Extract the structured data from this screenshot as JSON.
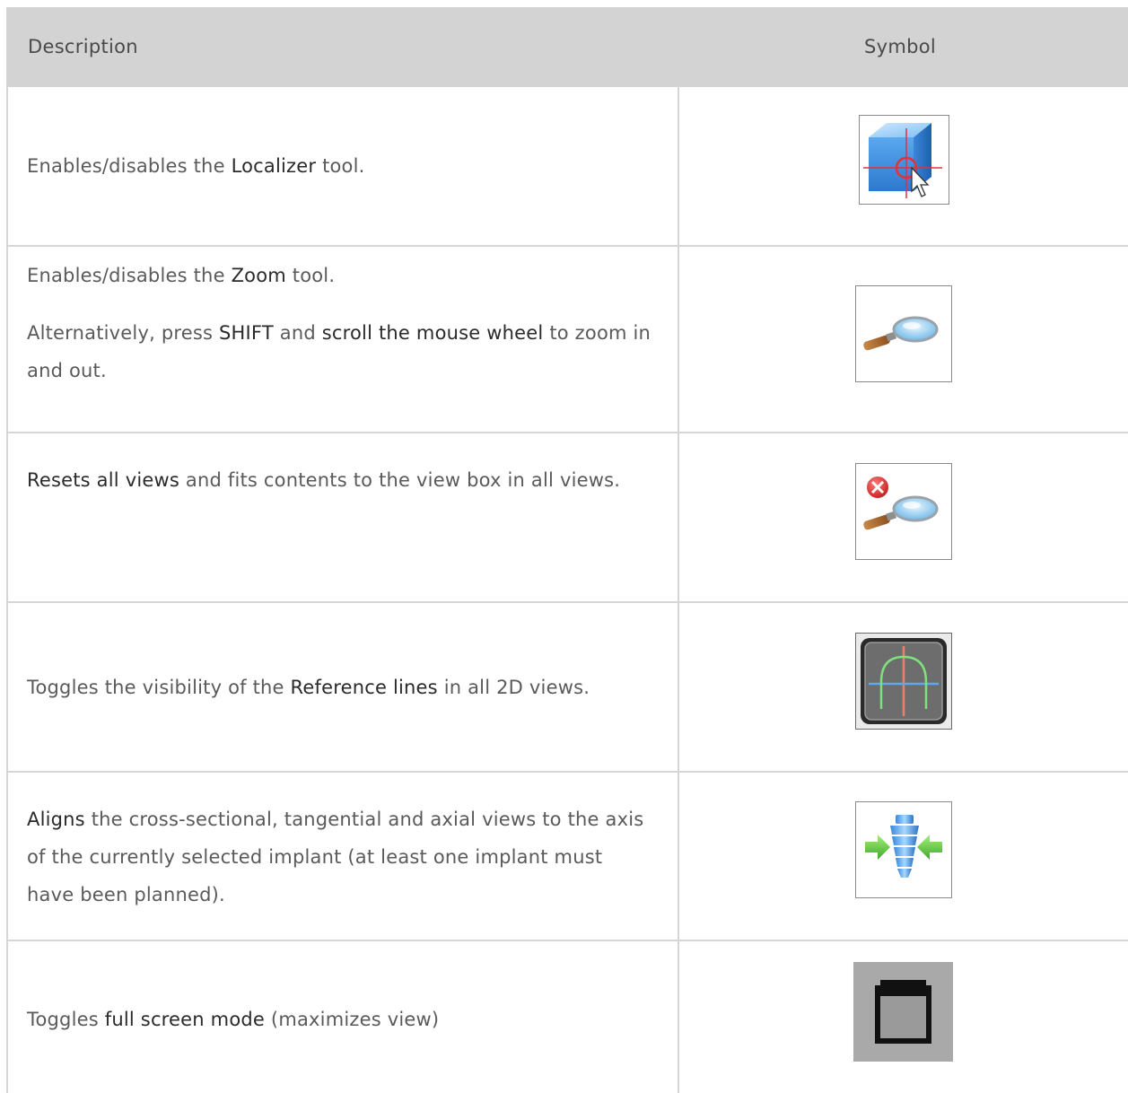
{
  "header": {
    "description": "Description",
    "symbol": "Symbol"
  },
  "rows": [
    {
      "icon": "localizer-icon",
      "pre": "Enables/disables the ",
      "bold": "Localizer",
      "post": " tool."
    },
    {
      "icon": "zoom-icon",
      "pre": "Enables/disables the ",
      "bold": "Zoom",
      "post": " tool.",
      "line2_a": "Alternatively, press ",
      "line2_b": "SHIFT",
      "line2_c": " and ",
      "line2_d": "scroll the mouse wheel",
      "line2_e": " to zoom in and out."
    },
    {
      "icon": "reset-zoom-icon",
      "bold": "Resets all views",
      "post": " and fits contents to the view box in all views."
    },
    {
      "icon": "reference-lines-icon",
      "pre": "Toggles the visibility of the ",
      "bold": "Reference lines",
      "post": " in all 2D views."
    },
    {
      "icon": "align-to-implant-icon",
      "bold": "Aligns",
      "post": " the cross-sectional, tangential and axial views to the axis of the currently selected implant (at least one implant must have been planned)."
    },
    {
      "icon": "full-screen-icon",
      "pre": "Toggles ",
      "bold": "full screen mode",
      "post": " (maximizes view)"
    }
  ]
}
